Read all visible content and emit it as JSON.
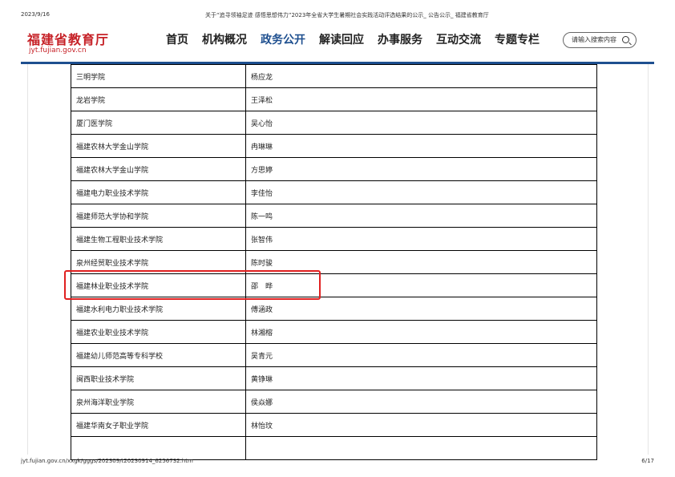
{
  "print_header": {
    "date": "2023/9/16",
    "title": "关于“追寻领袖足迹 感悟思想伟力”2023年全省大学生暑期社会实践活动评选结果的公示_ 公告公示_ 福建省教育厅"
  },
  "site": {
    "logo_text": "福建省教育厅",
    "logo_url": "jyt.fujian.gov.cn",
    "nav": [
      {
        "label": "首页"
      },
      {
        "label": "机构概况"
      },
      {
        "label": "政务公开",
        "active": true
      },
      {
        "label": "解读回应"
      },
      {
        "label": "办事服务"
      },
      {
        "label": "互动交流"
      },
      {
        "label": "专题专栏"
      }
    ],
    "search_placeholder": "请输入搜索内容"
  },
  "table": {
    "rows": [
      {
        "school": "三明学院",
        "name": "杨应龙"
      },
      {
        "school": "龙岩学院",
        "name": "王泽松"
      },
      {
        "school": "厦门医学院",
        "name": "吴心怡"
      },
      {
        "school": "福建农林大学金山学院",
        "name": "冉琳琳"
      },
      {
        "school": "福建农林大学金山学院",
        "name": "方思婷"
      },
      {
        "school": "福建电力职业技术学院",
        "name": "李佳怡"
      },
      {
        "school": "福建师范大学协和学院",
        "name": "陈一鸣"
      },
      {
        "school": "福建生物工程职业技术学院",
        "name": "张智伟"
      },
      {
        "school": "泉州经贸职业技术学院",
        "name": "陈时骏"
      },
      {
        "school": "福建林业职业技术学院",
        "name": "邵　晔",
        "highlighted": true
      },
      {
        "school": "福建水利电力职业技术学院",
        "name": "傅涵政"
      },
      {
        "school": "福建农业职业技术学院",
        "name": "林湘榕"
      },
      {
        "school": "福建幼儿师范高等专科学校",
        "name": "吴青元"
      },
      {
        "school": "闽西职业技术学院",
        "name": "黄铮琳"
      },
      {
        "school": "泉州海洋职业学院",
        "name": "侯焱娜"
      },
      {
        "school": "福建华南女子职业学院",
        "name": "林怡玟"
      },
      {
        "school": "",
        "name": ""
      }
    ]
  },
  "print_footer": {
    "url": "jyt.fujian.gov.cn/xxgk/gggs/202309/t20230914_6256732.htm",
    "page": "6/17"
  },
  "colors": {
    "brand_red": "#c62127",
    "nav_active": "#1e4f8f",
    "highlight": "#e02020"
  }
}
